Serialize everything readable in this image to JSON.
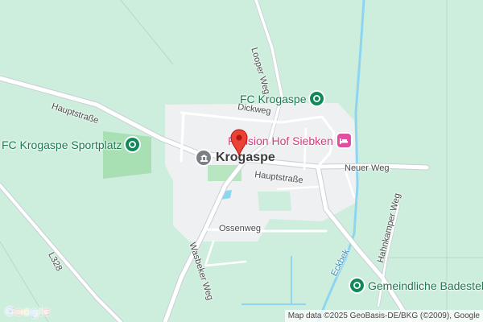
{
  "map": {
    "colors": {
      "land": "#cdeedd",
      "park": "#a8dfb3",
      "built_up": "#eef0f2",
      "road": "#ffffff",
      "road_edge": "#c9cfd6",
      "water": "#8ed6ef",
      "poi_green": "#11875a",
      "poi_pink": "#e24ea0",
      "marker": "#ea4335"
    },
    "streets": [
      {
        "name": "Hauptstraße",
        "id": "hauptstrasse-west"
      },
      {
        "name": "Looper Weg",
        "id": "looper-weg"
      },
      {
        "name": "Dickweg",
        "id": "dickweg"
      },
      {
        "name": "Hauptstraße",
        "id": "hauptstrasse-east"
      },
      {
        "name": "Neuer Weg",
        "id": "neuer-weg"
      },
      {
        "name": "Ossenweg",
        "id": "ossenweg"
      },
      {
        "name": "Wasbeker Weg",
        "id": "wasbeker-weg"
      },
      {
        "name": "Hahnkamper Weg",
        "id": "hahnkamper-weg"
      },
      {
        "name": "L328",
        "id": "l328"
      },
      {
        "name": "Eckbek",
        "id": "eckbek"
      }
    ],
    "town": {
      "name": "Krogaspe",
      "icon": "landmark-icon"
    },
    "pois": [
      {
        "name": "FC Krogaspe",
        "icon": "sports-icon",
        "category": "green"
      },
      {
        "name": "FC Krogaspe Sportplatz",
        "icon": "sports-icon",
        "category": "green"
      },
      {
        "name": "Pension Hof Siebken",
        "icon": "hotel-bed-icon",
        "category": "pink"
      },
      {
        "name": "Gemeindliche Badestell",
        "icon": "sports-icon",
        "category": "green"
      }
    ],
    "marker": {
      "icon": "location-pin-icon"
    },
    "logo": {
      "text": "Google"
    },
    "attribution": "Map data ©2025 GeoBasis-DE/BKG (©2009), Google"
  }
}
